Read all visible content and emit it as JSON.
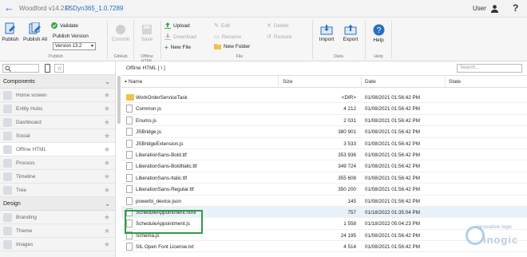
{
  "titlebar": {
    "app_title": "Woodford v14.2.0",
    "project": "FSDyn365_1.0.7289",
    "user": "User"
  },
  "ribbon": {
    "publish": "Publish",
    "publish_all": "Publish All",
    "validate": "Validate",
    "publish_version_label": "Publish Version",
    "publish_version_value": "Version 13.2",
    "commit": "Commit",
    "save": "Save",
    "upload": "Upload",
    "download": "Download",
    "new_file": "New File",
    "edit": "Edit",
    "rename": "Rename",
    "new_folder": "New Folder",
    "delete": "Delete",
    "restore": "Restore",
    "import": "Import",
    "export": "Export",
    "help": "Help",
    "groups": {
      "publish": "Publish",
      "github": "GitHub",
      "offline_html": "Offline HTML",
      "file": "File",
      "data": "Data",
      "help": "Help"
    }
  },
  "sidebar": {
    "components_header": "Components",
    "components": [
      {
        "label": "Home screen",
        "icon": "home-icon"
      },
      {
        "label": "Entity Hubs",
        "icon": "hub-icon"
      },
      {
        "label": "Dashboard",
        "icon": "dashboard-icon"
      },
      {
        "label": "Social",
        "icon": "social-icon"
      },
      {
        "label": "Offline HTML",
        "icon": "html-icon"
      },
      {
        "label": "Process",
        "icon": "process-icon"
      },
      {
        "label": "Timeline",
        "icon": "timeline-icon"
      },
      {
        "label": "Tree",
        "icon": "tree-icon"
      }
    ],
    "design_header": "Design",
    "design": [
      {
        "label": "Branding",
        "icon": "branding-icon"
      },
      {
        "label": "Theme",
        "icon": "theme-icon"
      },
      {
        "label": "Images",
        "icon": "images-icon"
      }
    ]
  },
  "main": {
    "path": "Offline HTML [ \\ ]",
    "search_placeholder": "Search...",
    "columns": [
      "Name",
      "Size",
      "Date",
      "State"
    ],
    "rows": [
      {
        "name": "WorkOrderServiceTask",
        "size": "<DIR>",
        "date": "01/08/2021 01:56:42 PM",
        "type": "folder"
      },
      {
        "name": "Common.js",
        "size": "4 212",
        "date": "01/08/2021 01:56:42 PM",
        "type": "file"
      },
      {
        "name": "Enums.js",
        "size": "2 031",
        "date": "01/08/2021 01:56:42 PM",
        "type": "file"
      },
      {
        "name": "JSBridge.js",
        "size": "380 901",
        "date": "01/08/2021 01:56:42 PM",
        "type": "file"
      },
      {
        "name": "JSBridgeExtension.js",
        "size": "3 533",
        "date": "01/08/2021 01:56:42 PM",
        "type": "file"
      },
      {
        "name": "LiberationSans-Bold.ttf",
        "size": "353 936",
        "date": "01/08/2021 01:56:42 PM",
        "type": "file"
      },
      {
        "name": "LiberationSans-BoldItalic.ttf",
        "size": "349 724",
        "date": "01/08/2021 01:56:42 PM",
        "type": "file"
      },
      {
        "name": "LiberationSans-Italic.ttf",
        "size": "355 608",
        "date": "01/08/2021 01:56:42 PM",
        "type": "file"
      },
      {
        "name": "LiberationSans-Regular.ttf",
        "size": "350 200",
        "date": "01/08/2021 01:56:42 PM",
        "type": "file"
      },
      {
        "name": "powerbi_device.json",
        "size": "145",
        "date": "01/08/2021 01:56:42 PM",
        "type": "file"
      },
      {
        "name": "ScheduleAppointment.html",
        "size": "757",
        "date": "01/18/2022 01:35:04 PM",
        "type": "file"
      },
      {
        "name": "ScheduleAppointment.js",
        "size": "1 558",
        "date": "01/18/2022 05:04:23 PM",
        "type": "file"
      },
      {
        "name": "Schema.js",
        "size": "24 195",
        "date": "01/08/2021 01:56:42 PM",
        "type": "file"
      },
      {
        "name": "SIL Open Font License.txt",
        "size": "4 514",
        "date": "01/08/2021 01:56:42 PM",
        "type": "file"
      }
    ]
  },
  "watermark": {
    "tagline": "innovative logic",
    "brand": "inogic"
  }
}
